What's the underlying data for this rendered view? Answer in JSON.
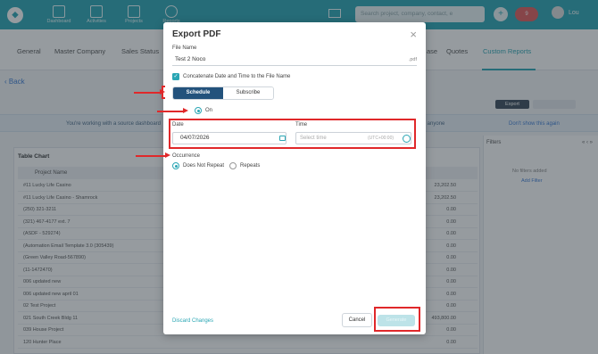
{
  "nav": {
    "items": [
      {
        "label": "Dashboard",
        "icon": "dashboard-icon"
      },
      {
        "label": "Activities",
        "icon": "activities-icon"
      },
      {
        "label": "Projects",
        "icon": "projects-icon"
      },
      {
        "label": "Reports",
        "icon": "reports-icon"
      }
    ],
    "search_placeholder": "Search project, company, contact, e",
    "badge": "9",
    "user": "Lou"
  },
  "subnav": {
    "tabs": [
      "General",
      "Master Company",
      "Sales Status",
      "Quotes",
      "Custom Reports"
    ],
    "tab_partial": "ase"
  },
  "back_label": "Back",
  "export_label": "Export",
  "banner": {
    "text": "You're working with a source dashboard",
    "tail": "and anyone",
    "dismiss": "Don't show this again"
  },
  "table": {
    "title": "Table Chart",
    "column": "Project Name",
    "rows": [
      {
        "name": "#11 Lucky Life Casino",
        "value": "23,202.50"
      },
      {
        "name": "#11 Lucky Life Casino - Shamrock",
        "value": "23,202.50"
      },
      {
        "name": "(250) 321-3211",
        "value": "0.00"
      },
      {
        "name": "(321) 467-4177 ext. 7",
        "value": "0.00"
      },
      {
        "name": "(ASDF - 529274)",
        "value": "0.00"
      },
      {
        "name": "(Automation Email Template 3.0 (305439)",
        "value": "0.00"
      },
      {
        "name": "(Green Valley Road-567890)",
        "value": "0.00"
      },
      {
        "name": "(11-1472470)",
        "value": "0.00"
      },
      {
        "name": "006 updated new",
        "value": "0.00"
      },
      {
        "name": "006 updated new april 01",
        "value": "0.00"
      },
      {
        "name": "02 Test Project",
        "value": "0.00"
      },
      {
        "name": "021 South Creek Bldg 11",
        "value": "493,800.00"
      },
      {
        "name": "039 House Project",
        "value": "0.00"
      },
      {
        "name": "120 Hunter Place",
        "value": "0.00"
      }
    ]
  },
  "filters": {
    "title": "Filters",
    "empty": "No filters added",
    "add": "Add Filter"
  },
  "modal": {
    "title": "Export PDF",
    "file_name_label": "File Name",
    "file_name_value": "Test 2 Noco",
    "file_suffix": ".pdf",
    "concat_label": "Concatenate Date and Time to the File Name",
    "seg_schedule": "Schedule",
    "seg_subscribe": "Subscribe",
    "on_label": "On",
    "date_label": "Date",
    "date_value": "04/07/2026",
    "time_label": "Time",
    "time_placeholder": "Select time",
    "time_tz": "(UTC+00:00)",
    "occurrence_label": "Occurrence",
    "opt_not_repeat": "Does Not Repeat",
    "opt_repeats": "Repeats",
    "discard": "Discard Changes",
    "cancel": "Cancel",
    "generate": "Generate"
  },
  "colors": {
    "brand": "#2aa6b4",
    "segment_active": "#23527c",
    "annotation": "#e0282a"
  }
}
